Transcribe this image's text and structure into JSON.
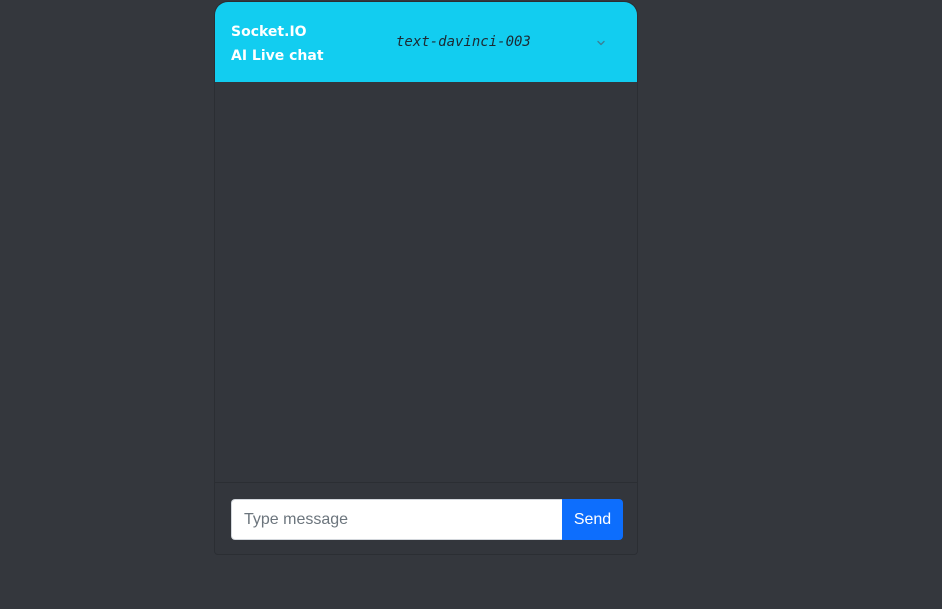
{
  "header": {
    "title_line1": "Socket.IO",
    "title_line2": "AI Live chat",
    "model_selected": "text-davinci-003"
  },
  "composer": {
    "placeholder": "Type message",
    "value": "",
    "send_label": "Send"
  },
  "colors": {
    "background": "#34373d",
    "header": "#12cdf0",
    "send_button": "#0d6efd"
  },
  "icons": {
    "model_dropdown": "chevron-down-icon"
  }
}
